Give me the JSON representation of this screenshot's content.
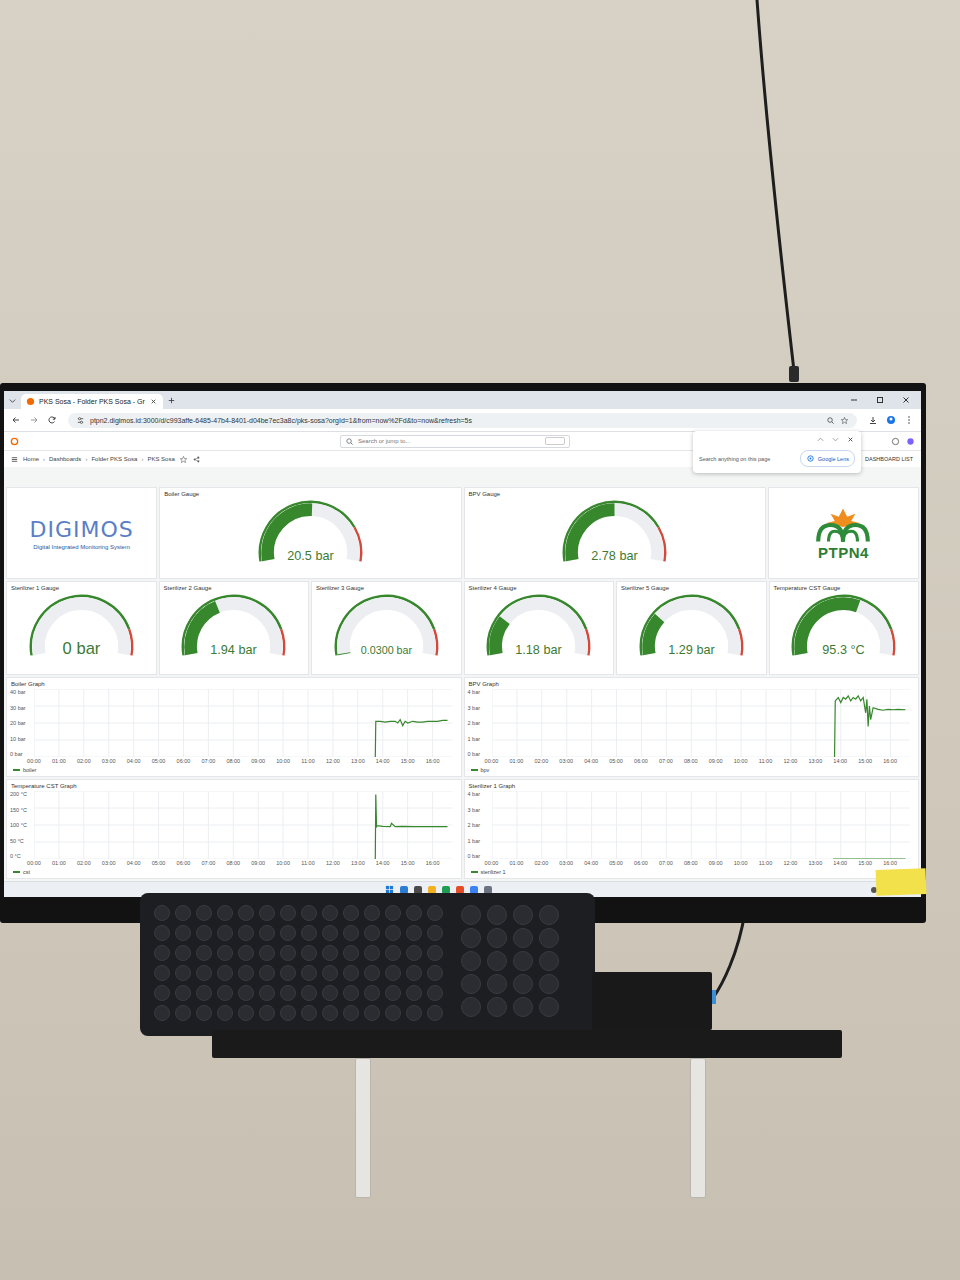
{
  "browser": {
    "tabs": [
      {
        "label": "PKS Sosa - Folder PKS Sosa - Gr",
        "selected": true
      }
    ],
    "url": "ptpn2.digimos.id:3000/d/c993affe-6485-47b4-8401-d04be7ec3a8c/pks-sosa?orgId=1&from=now%2Fd&to=now&refresh=5s",
    "find_popup": {
      "placeholder": "Search anything on this page",
      "lens": "Google Lens"
    }
  },
  "grafana": {
    "search": "Search or jump to...",
    "breadcrumbs": [
      "Home",
      "Dashboards",
      "Folder PKS Sosa",
      "PKS Sosa"
    ],
    "separator": "›",
    "refresh": "5s",
    "dashboard_list": "DASHBOARD LIST"
  },
  "row1": [
    {
      "kind": "digimos-logo",
      "title": "DIGIMOS",
      "subtitle": "Digital Integrated Monitoring System"
    },
    {
      "kind": "gauge",
      "title": "Boiler Gauge",
      "value": "20.5 bar",
      "level": 0.51,
      "threshold": 0.8
    },
    {
      "kind": "gauge",
      "title": "BPV Gauge",
      "value": "2.78 bar",
      "level": 0.5,
      "threshold": 0.8
    },
    {
      "kind": "ptpn-logo",
      "title": "PTPN4"
    }
  ],
  "row2": [
    {
      "title": "Sterilizer 1 Gauge",
      "value": "0 bar",
      "level": 0,
      "threshold": 0.85
    },
    {
      "title": "Sterilizer 2 Gauge",
      "value": "1.94 bar",
      "level": 0.39,
      "threshold": 0.85
    },
    {
      "title": "Sterilizer 3 Gauge",
      "value": "0.0300 bar",
      "level": 0.006,
      "threshold": 0.85
    },
    {
      "title": "Sterilizer 4 Gauge",
      "value": "1.18 bar",
      "level": 0.24,
      "threshold": 0.85
    },
    {
      "title": "Sterilizer 5 Gauge",
      "value": "1.29 bar",
      "level": 0.26,
      "threshold": 0.85
    },
    {
      "title": "Temperature CST Gauge",
      "value": "95.3 °C",
      "level": 0.6,
      "threshold": 0.85
    }
  ],
  "time_axis": {
    "ticks": [
      "00:00",
      "01:00",
      "02:00",
      "03:00",
      "04:00",
      "05:00",
      "06:00",
      "07:00",
      "08:00",
      "09:00",
      "10:00",
      "11:00",
      "12:00",
      "13:00",
      "14:00",
      "15:00",
      "16:00"
    ],
    "max_hour": 16.8
  },
  "charts": [
    {
      "title": "Boiler Graph",
      "y_ticks": [
        "40 bar",
        "30 bar",
        "20 bar",
        "10 bar",
        "0 bar"
      ],
      "y_max": 40,
      "legend": "boiler",
      "t": [
        13.7,
        13.72,
        13.9,
        14.1,
        14.3,
        14.5,
        14.6,
        14.7,
        14.8,
        14.9,
        15.0,
        15.2,
        15.4,
        15.6,
        15.8,
        16.0,
        16.2,
        16.4,
        16.6
      ],
      "values": [
        0,
        21,
        21,
        20.5,
        21,
        21,
        20,
        22,
        18.5,
        21,
        20,
        21,
        20.5,
        20.5,
        21,
        21,
        21,
        21.5,
        21.5
      ]
    },
    {
      "title": "BPV Graph",
      "y_ticks": [
        "4 bar",
        "3 bar",
        "2 bar",
        "1 bar",
        "0 bar"
      ],
      "y_max": 4,
      "legend": "bpv",
      "t": [
        13.75,
        13.78,
        13.9,
        14.0,
        14.1,
        14.2,
        14.3,
        14.4,
        14.5,
        14.6,
        14.7,
        14.8,
        14.9,
        15.0,
        15.05,
        15.1,
        15.15,
        15.2,
        15.3,
        15.5,
        15.7,
        15.9,
        16.1,
        16.3,
        16.6
      ],
      "values": [
        0,
        3.3,
        3.5,
        3.2,
        3.5,
        3.4,
        3.6,
        3.3,
        3.5,
        3.4,
        3.6,
        3.3,
        3.5,
        2.6,
        3.4,
        1.8,
        3.0,
        2.2,
        2.9,
        2.8,
        2.75,
        2.8,
        2.78,
        2.8,
        2.78
      ]
    },
    {
      "title": "Temperature CST Graph",
      "y_ticks": [
        "200 °C",
        "150 °C",
        "100 °C",
        "50 °C",
        "0 °C"
      ],
      "y_max": 200,
      "legend": "cst",
      "t": [
        13.7,
        13.72,
        13.75,
        13.78,
        14.0,
        14.3,
        14.35,
        14.5,
        14.8,
        15.2,
        15.6,
        16.0,
        16.4,
        16.6
      ],
      "values": [
        0,
        190,
        95,
        98,
        96,
        95,
        105,
        95,
        96,
        95,
        95,
        95,
        95,
        95.3
      ]
    },
    {
      "title": "Sterilizer 1 Graph",
      "y_ticks": [
        "4 bar",
        "3 bar",
        "2 bar",
        "1 bar",
        "0 bar"
      ],
      "y_max": 4,
      "legend": "sterilizer 1",
      "t": [
        13.7,
        16.6
      ],
      "values": [
        0,
        0
      ]
    }
  ]
}
